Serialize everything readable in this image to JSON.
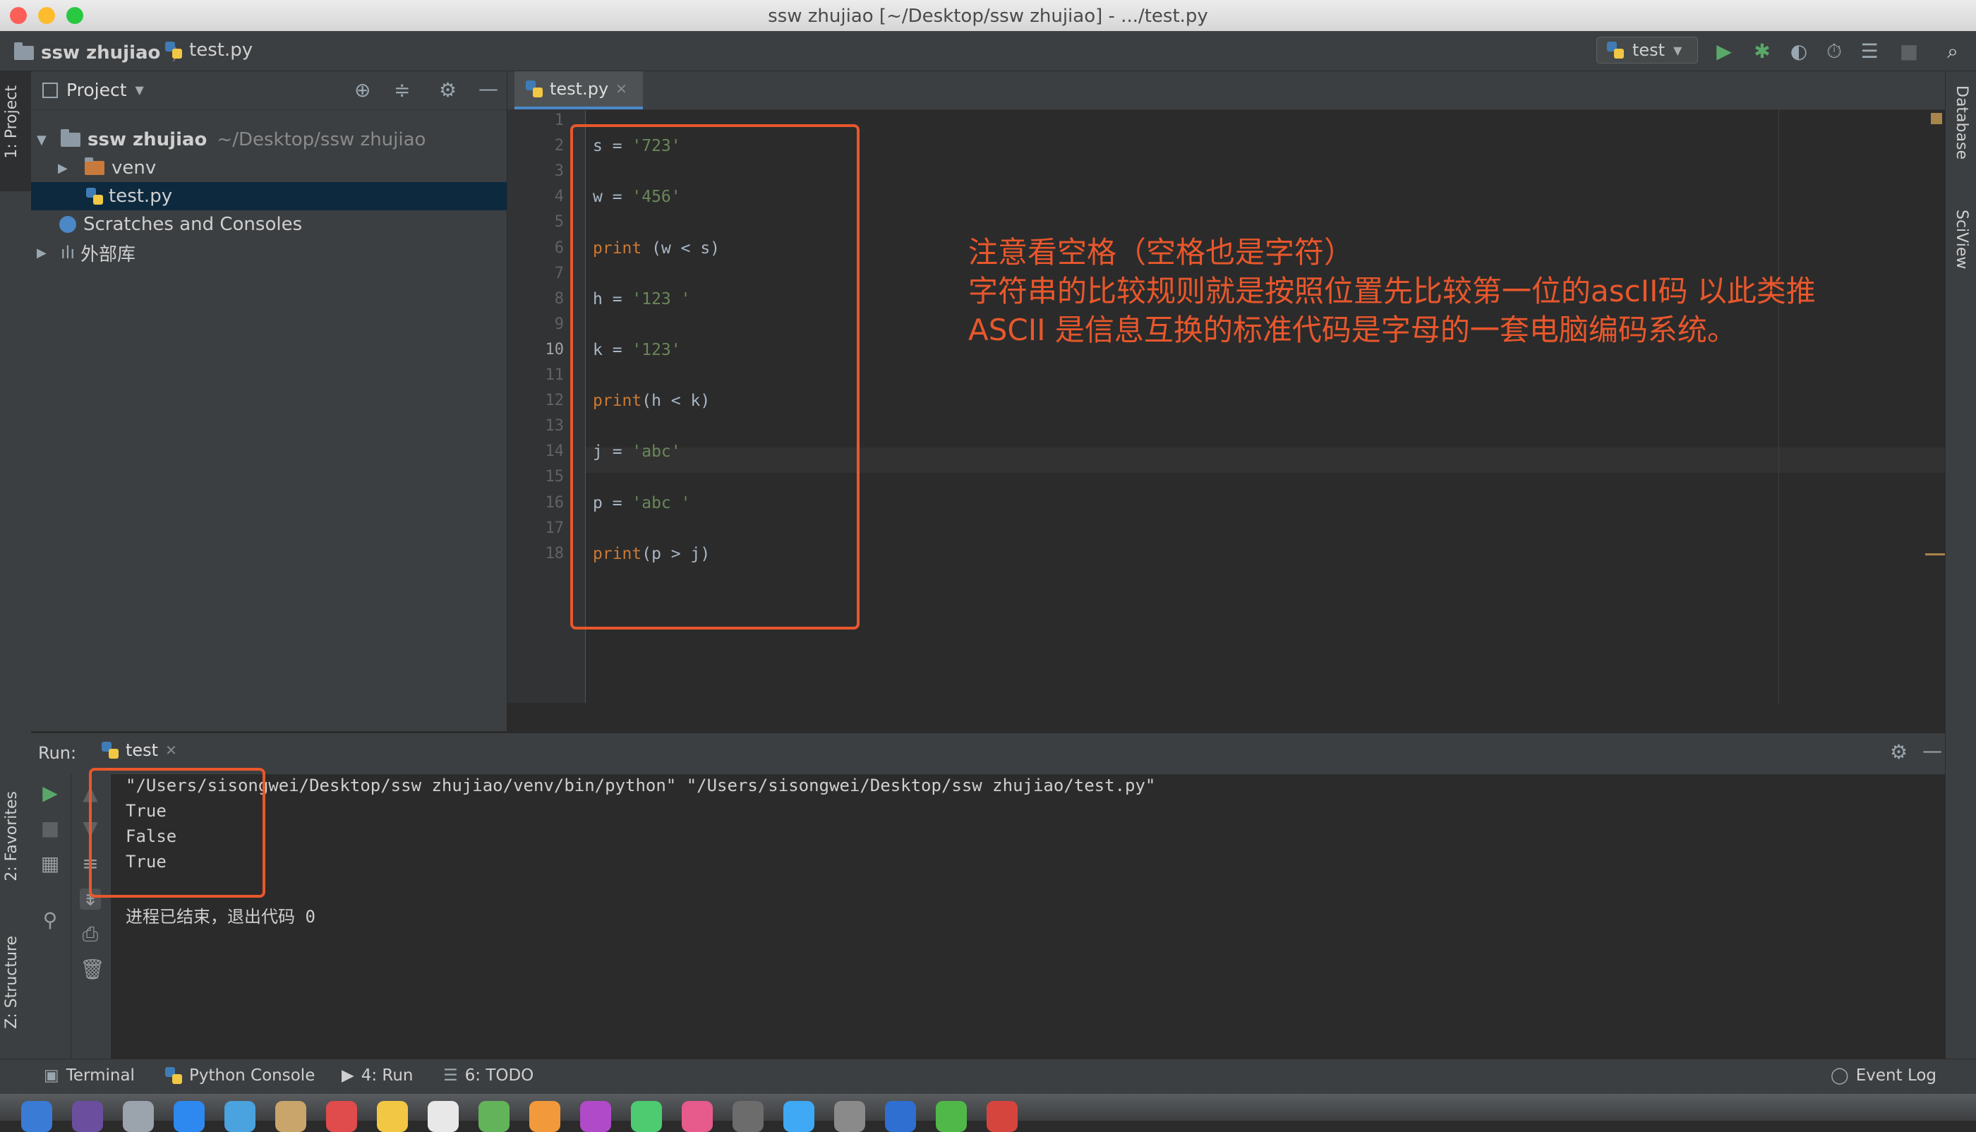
{
  "window": {
    "title": "ssw zhujiao [~/Desktop/ssw zhujiao] - .../test.py"
  },
  "navbar": {
    "project": "ssw zhujiao",
    "file": "test.py",
    "run_config": "test"
  },
  "left_stripe": {
    "project_tab": "1: Project",
    "favorites_tab": "2: Favorites",
    "structure_tab": "Z: Structure"
  },
  "right_stripe": {
    "database_tab": "Database",
    "sciview_tab": "SciView"
  },
  "project_panel": {
    "header": "Project",
    "root_name": "ssw zhujiao",
    "root_path": "~/Desktop/ssw zhujiao",
    "items": [
      {
        "label": "venv"
      },
      {
        "label": "test.py"
      },
      {
        "label": "Scratches and Consoles"
      },
      {
        "label": "外部库"
      }
    ]
  },
  "editor": {
    "tab": "test.py",
    "line_numbers": [
      "1",
      "2",
      "3",
      "4",
      "5",
      "6",
      "7",
      "8",
      "9",
      "10",
      "11",
      "12",
      "13",
      "14",
      "15",
      "16",
      "17",
      "18"
    ],
    "lines": [
      {
        "ln": 2,
        "parts": [
          [
            "v",
            "s = "
          ],
          [
            "s",
            "'723'"
          ]
        ]
      },
      {
        "ln": 4,
        "parts": [
          [
            "v",
            "w = "
          ],
          [
            "s",
            "'456'"
          ]
        ]
      },
      {
        "ln": 6,
        "parts": [
          [
            "k",
            "print"
          ],
          [
            "v",
            " (w < s)"
          ]
        ]
      },
      {
        "ln": 8,
        "parts": [
          [
            "v",
            "h = "
          ],
          [
            "s",
            "'123 '"
          ]
        ]
      },
      {
        "ln": 10,
        "parts": [
          [
            "v",
            "k = "
          ],
          [
            "s",
            "'123'"
          ]
        ]
      },
      {
        "ln": 12,
        "parts": [
          [
            "k",
            "print"
          ],
          [
            "v",
            "(h < k)"
          ]
        ]
      },
      {
        "ln": 14,
        "parts": [
          [
            "v",
            "j = "
          ],
          [
            "s",
            "'abc'"
          ]
        ]
      },
      {
        "ln": 16,
        "parts": [
          [
            "v",
            "p = "
          ],
          [
            "s",
            "'abc '"
          ]
        ]
      },
      {
        "ln": 18,
        "parts": [
          [
            "k",
            "print"
          ],
          [
            "v",
            "(p > j)"
          ]
        ]
      }
    ]
  },
  "annotation": {
    "line1": "注意看空格（空格也是字符）",
    "line2": "字符串的比较规则就是按照位置先比较第一位的ascII码 以此类推",
    "line3": "ASCII 是信息互换的标准代码是字母的一套电脑编码系统。"
  },
  "run_panel": {
    "label": "Run:",
    "tab": "test",
    "output": [
      "\"/Users/sisongwei/Desktop/ssw zhujiao/venv/bin/python\" \"/Users/sisongwei/Desktop/ssw zhujiao/test.py\"",
      "True",
      "False",
      "True",
      "",
      "进程已结束，退出代码 0"
    ]
  },
  "bottom_tabs": {
    "terminal": "Terminal",
    "python_console": "Python Console",
    "run": "4: Run",
    "todo": "6: TODO",
    "event_log": "Event Log"
  },
  "colors": {
    "annotation": "#e8572c",
    "keyword": "#cc7832",
    "string": "#6a8759"
  }
}
